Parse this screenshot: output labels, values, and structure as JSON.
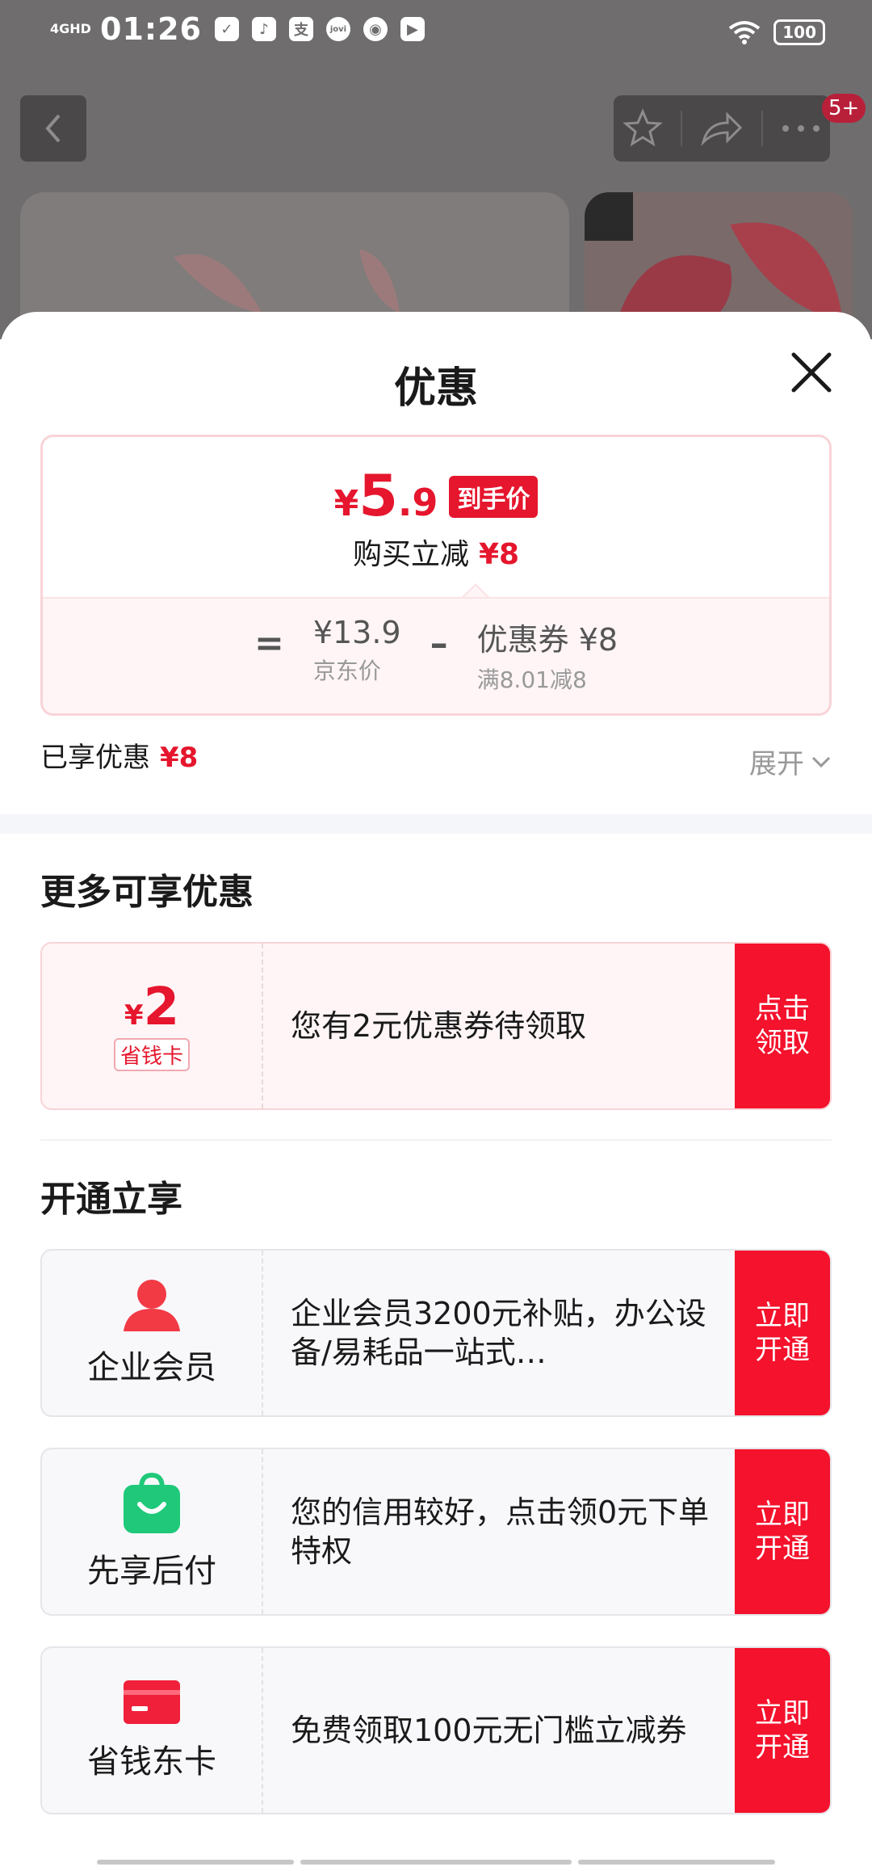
{
  "status_bar": {
    "network": "4GHD",
    "time": "01:26",
    "app_icons": [
      "check-icon",
      "tiktok-icon",
      "alipay-icon",
      "jovi-icon",
      "baidu-icon",
      "video-icon"
    ],
    "battery": "100"
  },
  "background_nav": {
    "badge": "5+"
  },
  "sheet": {
    "title": "优惠",
    "price": {
      "currency": "¥",
      "integer": "5",
      "decimal": ".9",
      "tag": "到手价",
      "reduce_label": "购买立减",
      "reduce_value": "¥8",
      "equals": "=",
      "minus": "–",
      "jd_price": "¥13.9",
      "jd_price_label": "京东价",
      "coupon_label": "优惠券 ¥8",
      "coupon_rule": "满8.01减8"
    },
    "enjoyed_label": "已享优惠",
    "enjoyed_value": "¥8",
    "expand_label": "展开"
  },
  "more_offers": {
    "title": "更多可享优惠",
    "coupon": {
      "currency": "¥",
      "amount": "2",
      "tag": "省钱卡",
      "description": "您有2元优惠券待领取",
      "button": "点击\n领取"
    }
  },
  "open_benefits": {
    "title": "开通立享",
    "items": [
      {
        "name": "企业会员",
        "icon": "user-icon",
        "description": "企业会员3200元补贴，办公设备/易耗品一站式…",
        "button": "立即开通"
      },
      {
        "name": "先享后付",
        "icon": "shopping-bag-icon",
        "description": "您的信用较好，点击领0元下单特权",
        "button": "立即开通"
      },
      {
        "name": "省钱东卡",
        "icon": "card-icon",
        "description": "免费领取100元无门槛立减券",
        "button": "立即开通"
      }
    ]
  },
  "colors": {
    "accent_red": "#e5162d",
    "button_red": "#f4122c",
    "member_icon": "#f23a45",
    "bag_icon": "#1fc979",
    "card_icon": "#f0203a"
  }
}
